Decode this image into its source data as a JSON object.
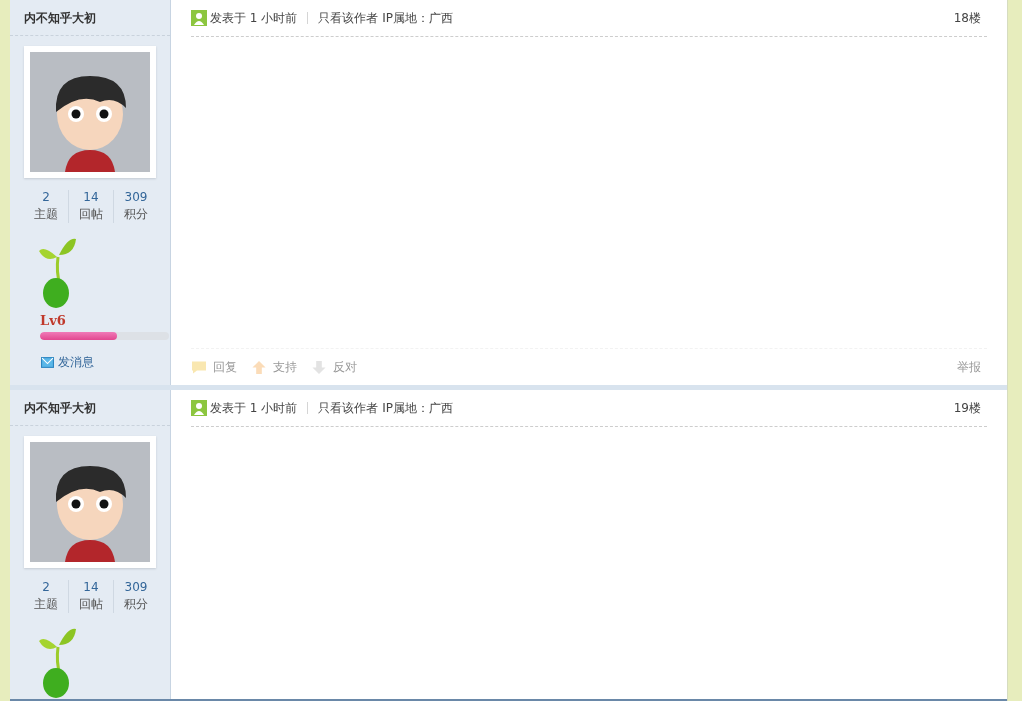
{
  "posts": [
    {
      "author": "内不知乎大初",
      "stats": [
        {
          "value": "2",
          "label": "主题"
        },
        {
          "value": "14",
          "label": "回帖"
        },
        {
          "value": "309",
          "label": "积分"
        }
      ],
      "level_label": "Lv6",
      "level": 0.6,
      "message_link": "发消息",
      "posted": "发表于 1 小时前",
      "author_only_link": "只看该作者",
      "ip_location": "IP属地：广西",
      "floor": "18楼",
      "actions": [
        {
          "kind": "reply",
          "label": "回复"
        },
        {
          "kind": "support",
          "label": "支持"
        },
        {
          "kind": "oppose",
          "label": "反对"
        }
      ],
      "report": "举报"
    },
    {
      "author": "内不知乎大初",
      "stats": [
        {
          "value": "2",
          "label": "主题"
        },
        {
          "value": "14",
          "label": "回帖"
        },
        {
          "value": "309",
          "label": "积分"
        }
      ],
      "posted": "发表于 1 小时前",
      "author_only_link": "只看该作者",
      "ip_location": "IP属地：广西",
      "floor": "19楼"
    }
  ]
}
